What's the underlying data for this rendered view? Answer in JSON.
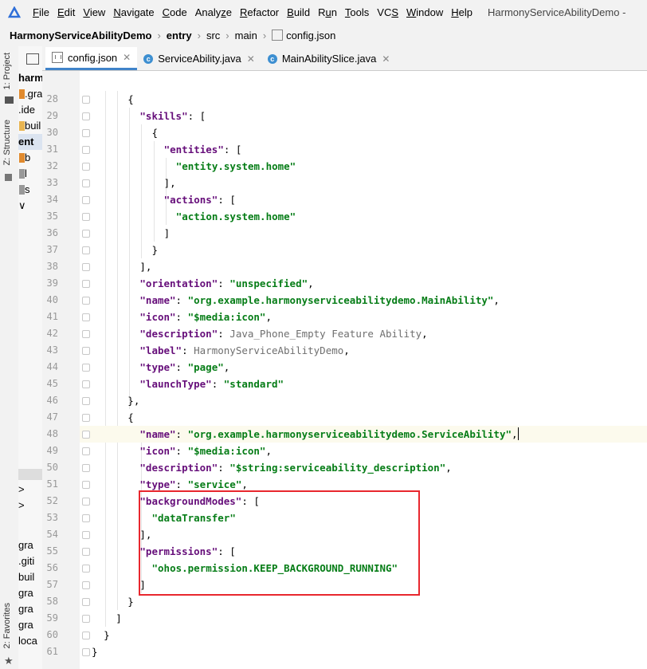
{
  "menubar": {
    "items": [
      "File",
      "Edit",
      "View",
      "Navigate",
      "Code",
      "Analyze",
      "Refactor",
      "Build",
      "Run",
      "Tools",
      "VCS",
      "Window",
      "Help"
    ],
    "mnemonics": [
      "F",
      "E",
      "V",
      "N",
      "C",
      "z",
      "R",
      "B",
      "u",
      "T",
      "S",
      "W",
      "H"
    ],
    "window_title": "HarmonyServiceAbilityDemo -"
  },
  "breadcrumb": [
    "HarmonyServiceAbilityDemo",
    "entry",
    "src",
    "main",
    "config.json"
  ],
  "left_strip": {
    "project_tab": "1: Project",
    "structure_tab": "Z: Structure",
    "favorites_tab": "2: Favorites"
  },
  "project_panel": {
    "rows": [
      {
        "text": "harmo",
        "bold": true
      },
      {
        "text": ".gra"
      },
      {
        "text": ".ide"
      },
      {
        "text": "buil"
      },
      {
        "text": "ent",
        "bold": true
      },
      {
        "text": "b"
      },
      {
        "text": "l"
      },
      {
        "text": "s"
      },
      {
        "text": "∨"
      },
      {
        "text": ""
      },
      {
        "text": ""
      },
      {
        "text": ""
      },
      {
        "text": ">"
      },
      {
        "text": ">"
      },
      {
        "text": "gra"
      },
      {
        "text": ".giti"
      },
      {
        "text": "buil"
      },
      {
        "text": "gra"
      },
      {
        "text": "gra"
      },
      {
        "text": "gra"
      },
      {
        "text": "loca"
      }
    ]
  },
  "tabs": [
    {
      "label": "config.json",
      "type": "json",
      "active": true
    },
    {
      "label": "ServiceAbility.java",
      "type": "class",
      "active": false
    },
    {
      "label": "MainAbilitySlice.java",
      "type": "class",
      "active": false
    }
  ],
  "editor": {
    "lines": [
      {
        "n": "28",
        "indent": 6,
        "t": [
          [
            "p",
            "{"
          ]
        ]
      },
      {
        "n": "29",
        "indent": 8,
        "t": [
          [
            "k",
            "\"skills\""
          ],
          [
            "p",
            ": ["
          ]
        ]
      },
      {
        "n": "30",
        "indent": 10,
        "t": [
          [
            "p",
            "{"
          ]
        ]
      },
      {
        "n": "31",
        "indent": 12,
        "t": [
          [
            "k",
            "\"entities\""
          ],
          [
            "p",
            ": ["
          ]
        ]
      },
      {
        "n": "32",
        "indent": 14,
        "t": [
          [
            "s",
            "\"entity.system.home\""
          ]
        ]
      },
      {
        "n": "33",
        "indent": 12,
        "t": [
          [
            "p",
            "],"
          ]
        ]
      },
      {
        "n": "34",
        "indent": 12,
        "t": [
          [
            "k",
            "\"actions\""
          ],
          [
            "p",
            ": ["
          ]
        ]
      },
      {
        "n": "35",
        "indent": 14,
        "t": [
          [
            "s",
            "\"action.system.home\""
          ]
        ]
      },
      {
        "n": "36",
        "indent": 12,
        "t": [
          [
            "p",
            "]"
          ]
        ]
      },
      {
        "n": "37",
        "indent": 10,
        "t": [
          [
            "p",
            "}"
          ]
        ]
      },
      {
        "n": "38",
        "indent": 8,
        "t": [
          [
            "p",
            "],"
          ]
        ]
      },
      {
        "n": "39",
        "indent": 8,
        "t": [
          [
            "k",
            "\"orientation\""
          ],
          [
            "p",
            ": "
          ],
          [
            "s",
            "\"unspecified\""
          ],
          [
            "p",
            ","
          ]
        ]
      },
      {
        "n": "40",
        "indent": 8,
        "t": [
          [
            "k",
            "\"name\""
          ],
          [
            "p",
            ": "
          ],
          [
            "s",
            "\"org.example.harmonyserviceabilitydemo.MainAbility\""
          ],
          [
            "p",
            ","
          ]
        ]
      },
      {
        "n": "41",
        "indent": 8,
        "t": [
          [
            "k",
            "\"icon\""
          ],
          [
            "p",
            ": "
          ],
          [
            "s",
            "\"$media:icon\""
          ],
          [
            "p",
            ","
          ]
        ]
      },
      {
        "n": "42",
        "indent": 8,
        "t": [
          [
            "k",
            "\"description\""
          ],
          [
            "p",
            ": "
          ],
          [
            "g",
            "Java_Phone_Empty Feature Ability"
          ],
          [
            "p",
            ","
          ]
        ]
      },
      {
        "n": "43",
        "indent": 8,
        "t": [
          [
            "k",
            "\"label\""
          ],
          [
            "p",
            ": "
          ],
          [
            "g",
            "HarmonyServiceAbilityDemo"
          ],
          [
            "p",
            ","
          ]
        ]
      },
      {
        "n": "44",
        "indent": 8,
        "t": [
          [
            "k",
            "\"type\""
          ],
          [
            "p",
            ": "
          ],
          [
            "s",
            "\"page\""
          ],
          [
            "p",
            ","
          ]
        ]
      },
      {
        "n": "45",
        "indent": 8,
        "t": [
          [
            "k",
            "\"launchType\""
          ],
          [
            "p",
            ": "
          ],
          [
            "s",
            "\"standard\""
          ]
        ]
      },
      {
        "n": "46",
        "indent": 6,
        "t": [
          [
            "p",
            "},"
          ]
        ]
      },
      {
        "n": "47",
        "indent": 6,
        "t": [
          [
            "p",
            "{"
          ]
        ]
      },
      {
        "n": "48",
        "indent": 8,
        "t": [
          [
            "k",
            "\"name\""
          ],
          [
            "p",
            ": "
          ],
          [
            "s",
            "\"org.example.harmonyserviceabilitydemo.ServiceAbility\""
          ],
          [
            "p",
            ","
          ],
          [
            "c",
            ""
          ]
        ],
        "hl": true
      },
      {
        "n": "49",
        "indent": 8,
        "t": [
          [
            "k",
            "\"icon\""
          ],
          [
            "p",
            ": "
          ],
          [
            "s",
            "\"$media:icon\""
          ],
          [
            "p",
            ","
          ]
        ]
      },
      {
        "n": "50",
        "indent": 8,
        "t": [
          [
            "k",
            "\"description\""
          ],
          [
            "p",
            ": "
          ],
          [
            "s",
            "\"$string:serviceability_description\""
          ],
          [
            "p",
            ","
          ]
        ]
      },
      {
        "n": "51",
        "indent": 8,
        "t": [
          [
            "k",
            "\"type\""
          ],
          [
            "p",
            ": "
          ],
          [
            "s",
            "\"service\""
          ],
          [
            "p",
            ","
          ]
        ]
      },
      {
        "n": "52",
        "indent": 8,
        "t": [
          [
            "k",
            "\"backgroundModes\""
          ],
          [
            "p",
            ": ["
          ]
        ]
      },
      {
        "n": "53",
        "indent": 10,
        "t": [
          [
            "s",
            "\"dataTransfer\""
          ]
        ]
      },
      {
        "n": "54",
        "indent": 8,
        "t": [
          [
            "p",
            "],"
          ]
        ]
      },
      {
        "n": "55",
        "indent": 8,
        "t": [
          [
            "k",
            "\"permissions\""
          ],
          [
            "p",
            ": ["
          ]
        ]
      },
      {
        "n": "56",
        "indent": 10,
        "t": [
          [
            "s",
            "\"ohos.permission.KEEP_BACKGROUND_RUNNING\""
          ]
        ]
      },
      {
        "n": "57",
        "indent": 8,
        "t": [
          [
            "p",
            "]"
          ]
        ]
      },
      {
        "n": "58",
        "indent": 6,
        "t": [
          [
            "p",
            "}"
          ]
        ]
      },
      {
        "n": "59",
        "indent": 4,
        "t": [
          [
            "p",
            "]"
          ]
        ]
      },
      {
        "n": "60",
        "indent": 2,
        "t": [
          [
            "p",
            "}"
          ]
        ]
      },
      {
        "n": "61",
        "indent": 0,
        "t": [
          [
            "p",
            "}"
          ]
        ]
      }
    ]
  },
  "colors": {
    "key": "#660e7a",
    "string": "#067d17",
    "highlight_box": "#e8272e",
    "active_tab_underline": "#4083c9",
    "current_line": "#fcfaed"
  }
}
